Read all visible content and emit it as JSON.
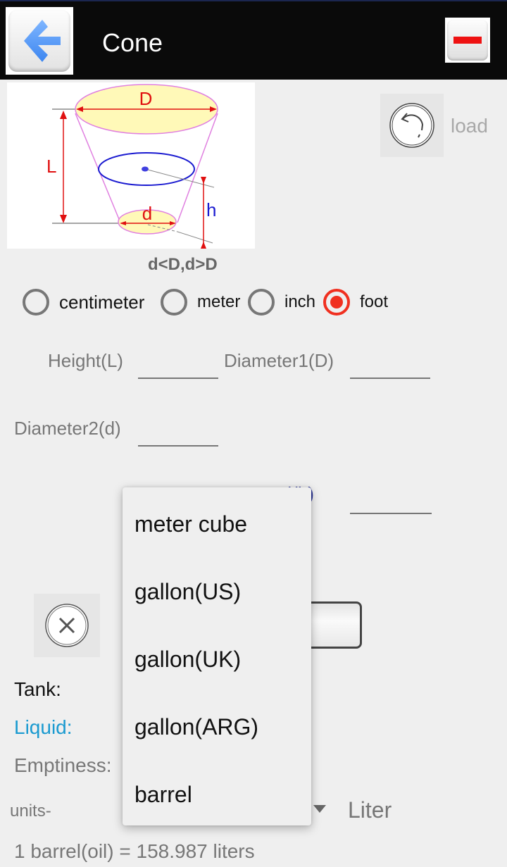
{
  "actionbar": {
    "title": "Cone",
    "back_icon": "back-arrow-icon",
    "minus_icon": "minus-icon"
  },
  "diagram": {
    "labels": {
      "D": "D",
      "L": "L",
      "d": "d",
      "h": "h"
    },
    "caption": "d<D,d>D",
    "colors": {
      "dimension": "#e01010",
      "level": "#1a1ad0",
      "outline": "#e080e0",
      "fill": "#fff9b8"
    }
  },
  "load": {
    "label": "load",
    "icon": "undo-icon"
  },
  "units": {
    "options": [
      {
        "label": "centimeter",
        "checked": false
      },
      {
        "label": "meter",
        "checked": false
      },
      {
        "label": "inch",
        "checked": false
      },
      {
        "label": "foot",
        "checked": true
      }
    ],
    "accent": "#f03020"
  },
  "fields": {
    "height": {
      "label": "Height(L)",
      "value": ""
    },
    "diameter1": {
      "label": "Diameter1(D)",
      "value": ""
    },
    "diameter2": {
      "label": "Diameter2(d)",
      "value": ""
    },
    "level": {
      "label": "Level(h)",
      "value": ""
    }
  },
  "actions": {
    "clear_icon": "clear-x-icon",
    "calculate_label": ""
  },
  "results": {
    "tank_label": "Tank:",
    "liquid_label": "Liquid:",
    "emptiness_label": "Emptiness:",
    "liquid_color": "#1a9ad0"
  },
  "volume_units": {
    "prefix": "units-",
    "right_unit": "Liter",
    "dropdown_options": [
      "meter cube",
      "gallon(US)",
      "gallon(UK)",
      "gallon(ARG)",
      "barrel"
    ]
  },
  "note": "1 barrel(oil) = 158.987 liters"
}
